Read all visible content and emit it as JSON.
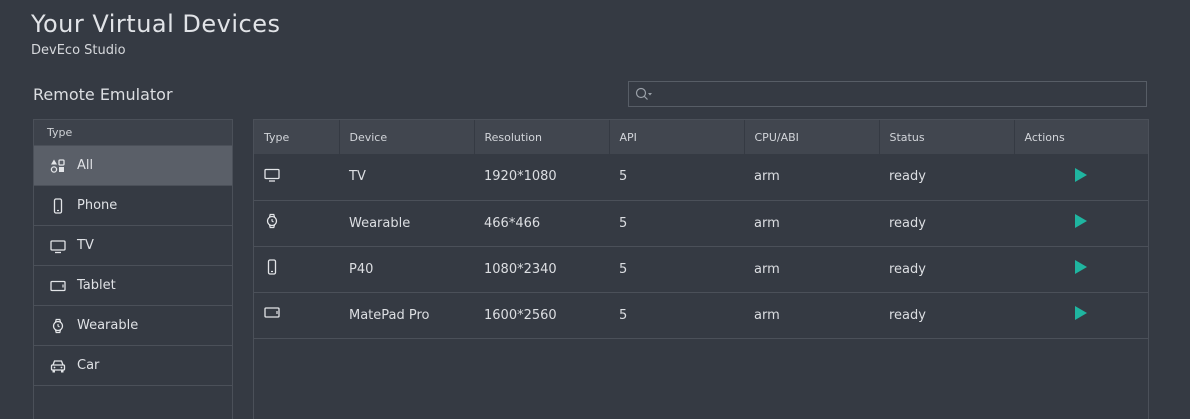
{
  "header": {
    "title": "Your Virtual Devices",
    "subtitle": "DevEco Studio"
  },
  "section": {
    "title": "Remote Emulator"
  },
  "search": {
    "value": "",
    "placeholder": ""
  },
  "sidebar": {
    "header": "Type",
    "items": [
      {
        "label": "All",
        "icon": "apps-icon",
        "active": true
      },
      {
        "label": "Phone",
        "icon": "phone-icon"
      },
      {
        "label": "TV",
        "icon": "tv-icon"
      },
      {
        "label": "Tablet",
        "icon": "tablet-icon"
      },
      {
        "label": "Wearable",
        "icon": "watch-icon"
      },
      {
        "label": "Car",
        "icon": "car-icon"
      }
    ]
  },
  "table": {
    "columns": [
      "Type",
      "Device",
      "Resolution",
      "API",
      "CPU/ABI",
      "Status",
      "Actions"
    ],
    "rows": [
      {
        "type_icon": "tv-icon",
        "device": "TV",
        "resolution": "1920*1080",
        "api": "5",
        "cpu": "arm",
        "status": "ready"
      },
      {
        "type_icon": "watch-icon",
        "device": "Wearable",
        "resolution": "466*466",
        "api": "5",
        "cpu": "arm",
        "status": "ready"
      },
      {
        "type_icon": "phone-icon",
        "device": "P40",
        "resolution": "1080*2340",
        "api": "5",
        "cpu": "arm",
        "status": "ready"
      },
      {
        "type_icon": "tablet-icon",
        "device": "MatePad Pro",
        "resolution": "1600*2560",
        "api": "5",
        "cpu": "arm",
        "status": "ready"
      }
    ]
  },
  "colors": {
    "background": "#353a43",
    "accent_play": "#1fb5a0",
    "active_item": "#5a5f68"
  }
}
